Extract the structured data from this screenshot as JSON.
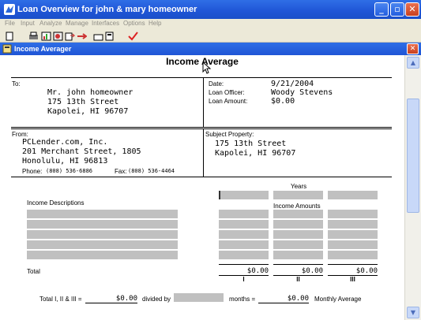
{
  "app": {
    "title": "Loan Overview for john & mary homeowner",
    "menu": [
      "File",
      "Input",
      "Analyze",
      "Manage",
      "Interfaces",
      "Options",
      "Help"
    ],
    "window_buttons": {
      "minimize": "_",
      "maximize": "▫",
      "close": "✕"
    }
  },
  "dialog": {
    "title": "Income Averager",
    "close": "✕"
  },
  "doc": {
    "heading": "Income Average",
    "to_label": "To:",
    "to_name": "Mr. john homeowner",
    "to_street": "175 13th Street",
    "to_city": "Kapolei, HI 96707",
    "date_label": "Date:",
    "date_value": "9/21/2004",
    "officer_label": "Loan Officer:",
    "officer_value": "Woody Stevens",
    "amount_label": "Loan Amount:",
    "amount_value": "$0.00",
    "from_label": "From:",
    "from_name": "PCLender.com, Inc.",
    "from_street": "201 Merchant Street, 1805",
    "from_city": "Honolulu, HI 96813",
    "phone_label": "Phone:",
    "phone_value": "(808) 536-6886",
    "fax_label": "Fax:",
    "fax_value": "(808) 536-4464",
    "subject_label": "Subject Property:",
    "subject_street": "175 13th Street",
    "subject_city": "Kapolei, HI 96707",
    "years_label": "Years",
    "income_desc_label": "Income Descriptions",
    "income_amounts_label": "Income Amounts",
    "total_label": "Total",
    "totals": [
      "$0.00",
      "$0.00",
      "$0.00"
    ],
    "roman": [
      "I",
      "II",
      "III"
    ],
    "bottom": {
      "total_label": "Total I, II & III =",
      "total_value": "$0.00",
      "divided_by": "divided by",
      "months": "months =",
      "monthly_value": "$0.00",
      "monthly_label": "Monthly Average"
    }
  },
  "colors": {
    "titlebar": "#1f55d6",
    "field_grey": "#c0c0c0",
    "close_red": "#d2492a"
  }
}
